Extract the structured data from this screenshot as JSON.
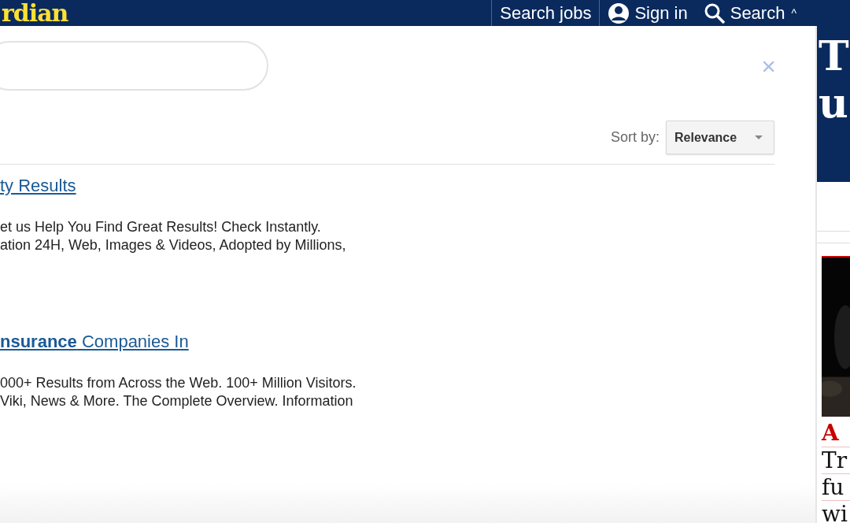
{
  "header": {
    "logo": "rdian",
    "links": [
      {
        "kind": "text",
        "label": "Search jobs"
      },
      {
        "kind": "account",
        "label": "Sign in"
      },
      {
        "kind": "search",
        "label": "Search",
        "caret": "^"
      }
    ]
  },
  "modal": {
    "close": "×",
    "sort": {
      "label": "Sort by:",
      "value": "Relevance"
    },
    "results": [
      {
        "title": "ty Results",
        "lines": [
          "et us Help You Find Great Results! Check Instantly.",
          "ation 24H, Web, Images & Videos, Adopted by Millions,"
        ]
      },
      {
        "title": "**nsurance** Companies In",
        "lines": [
          "000+ Results from Across the Web. 100+ Million Visitors.",
          "Viki, News & More. The Complete Overview. Information"
        ]
      }
    ]
  },
  "side": {
    "masthead_letters": [
      "T",
      "u"
    ],
    "kicker": "A",
    "headline_lines": [
      "Tr",
      "fu",
      "wi"
    ]
  }
}
